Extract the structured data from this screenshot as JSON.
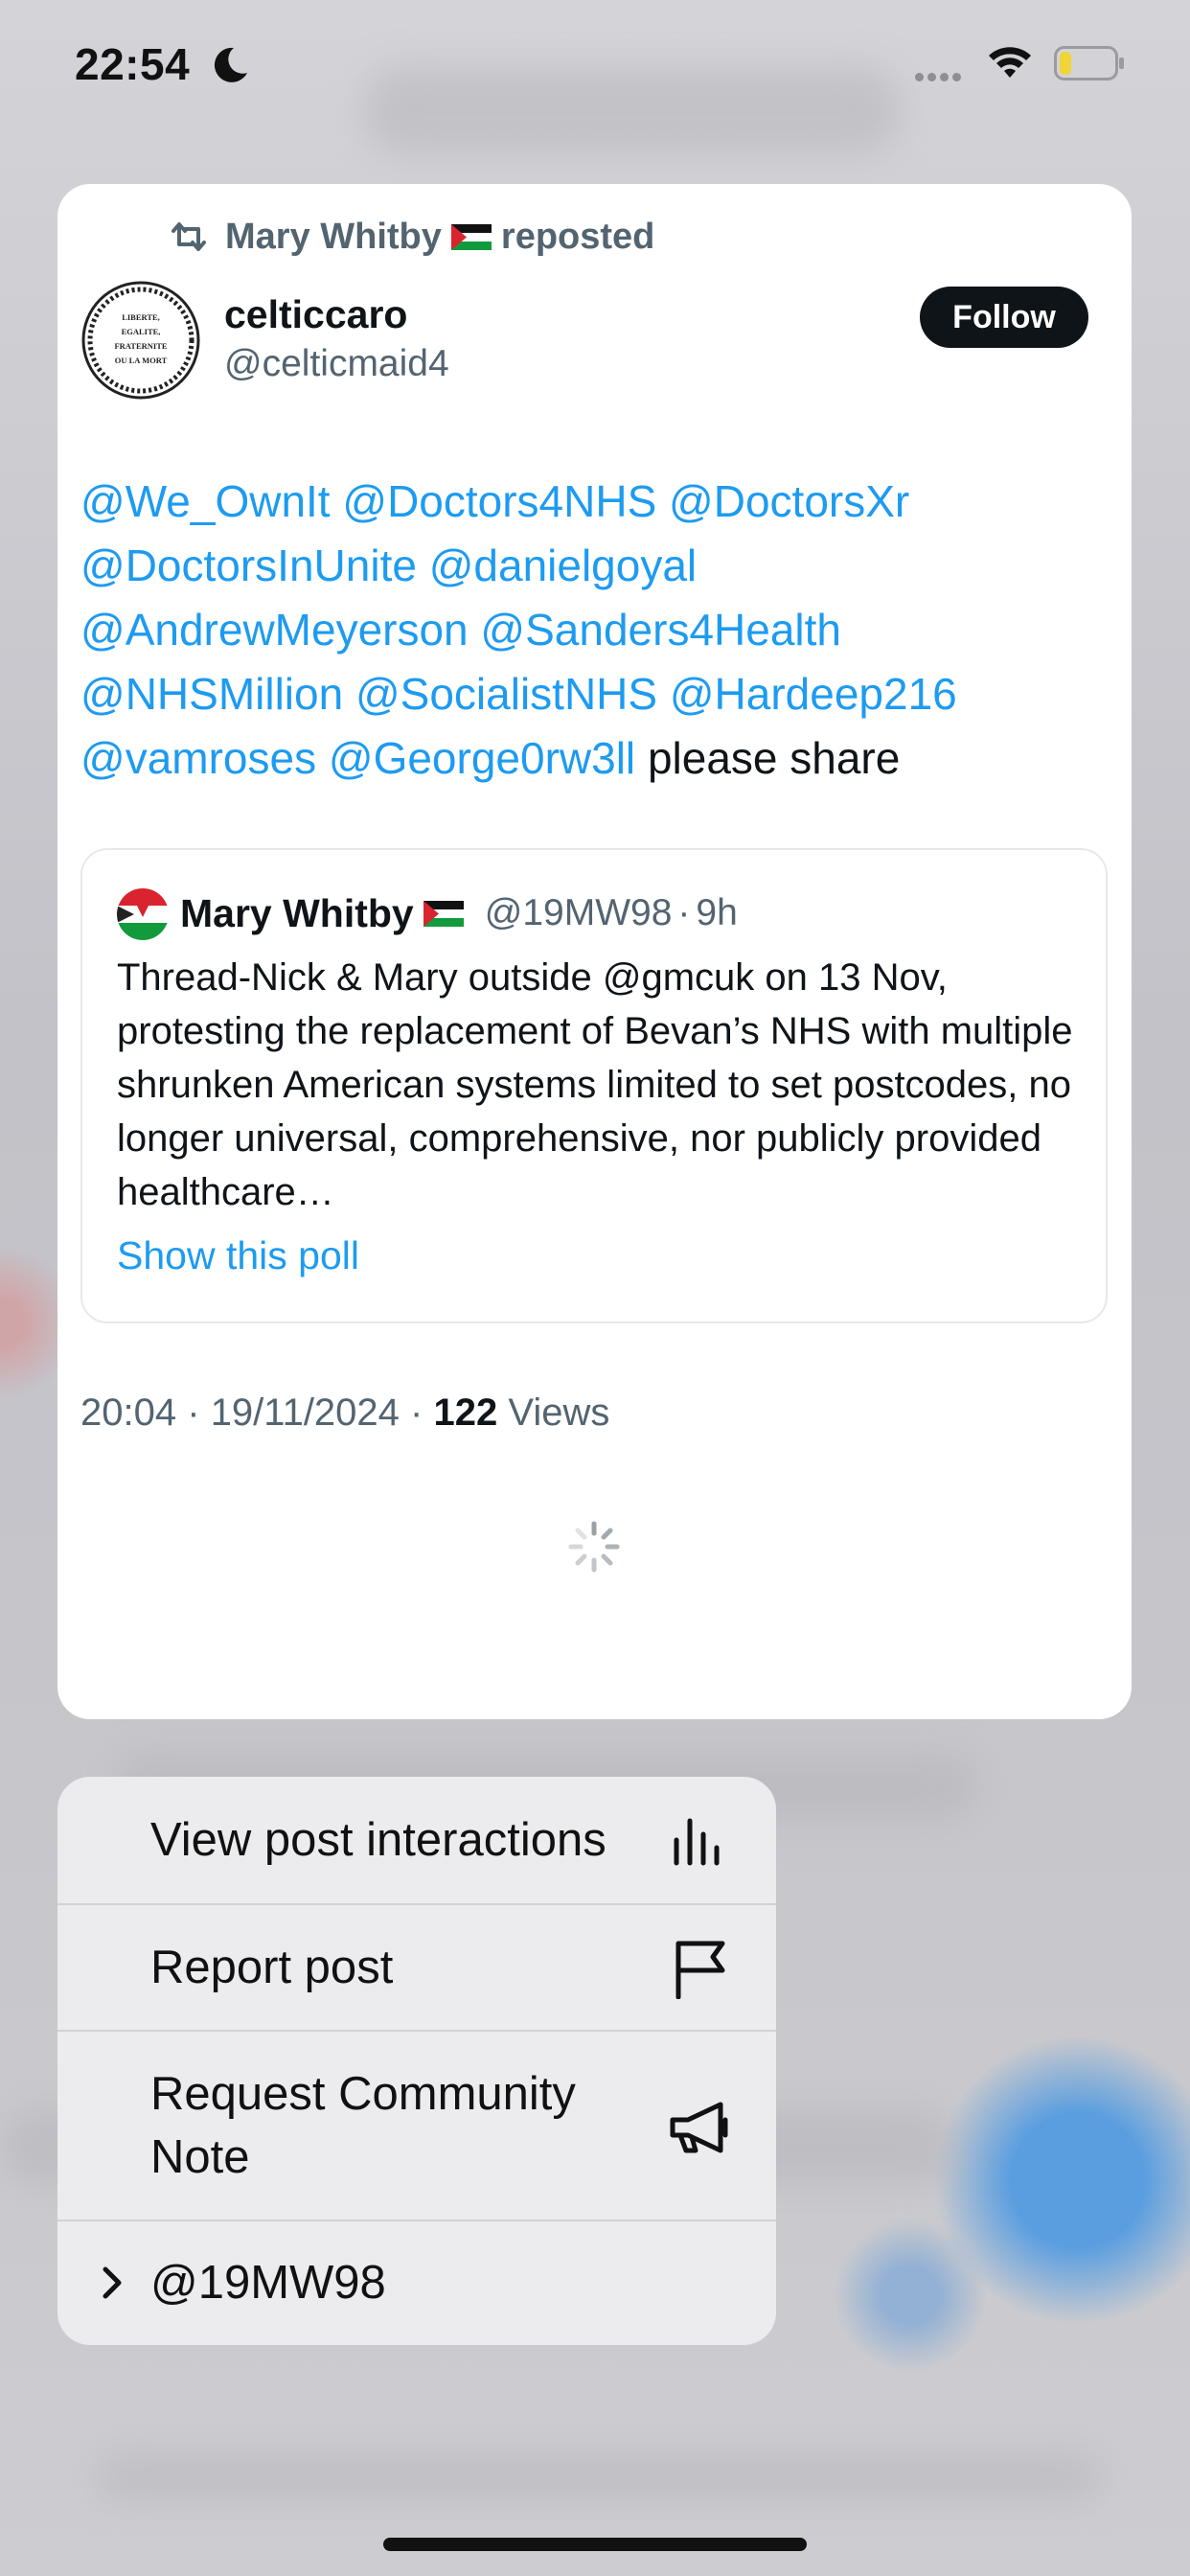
{
  "status_bar": {
    "time": "22:54",
    "icons": [
      "moon-icon",
      "signal-dots-icon",
      "wifi-icon",
      "battery-icon"
    ]
  },
  "post": {
    "repost_by": "Mary Whitby",
    "repost_suffix": "reposted",
    "display_name": "celticcaro",
    "handle": "@celticmaid4",
    "follow_label": "Follow",
    "avatar_text": [
      "LIBERTE,",
      "EGALITE,",
      "FRATERNITE",
      "OU LA MORT"
    ],
    "mentions": [
      "@We_OwnIt",
      "@Doctors4NHS",
      "@DoctorsXr",
      "@DoctorsInUnite",
      "@danielgoyal",
      "@AndrewMeyerson",
      "@Sanders4Health",
      "@NHSMillion",
      "@SocialistNHS",
      "@Hardeep216",
      "@vamroses",
      "@George0rw3ll"
    ],
    "text_tail": "please share",
    "quote": {
      "name": "Mary Whitby",
      "handle": "@19MW98",
      "separator": "·",
      "age": "9h",
      "body": "Thread-Nick & Mary outside @gmcuk on 13 Nov, protesting the replacement of Bevan’s NHS with multiple shrunken American systems limited to set postcodes, no longer universal, comprehensive, nor publicly provided healthcare…",
      "poll_link": "Show this poll"
    },
    "meta": {
      "time": "20:04",
      "date": "19/11/2024",
      "separator": "·",
      "views_count": "122",
      "views_label": "Views"
    }
  },
  "menu": {
    "items": [
      {
        "label": "View post interactions",
        "icon": "bar-chart-icon"
      },
      {
        "label": "Report post",
        "icon": "flag-icon"
      },
      {
        "label": "Request Community Note",
        "icon": "megaphone-icon"
      },
      {
        "label": "@19MW98",
        "icon": "chevron-right-icon"
      }
    ]
  },
  "colors": {
    "accent": "#1d9bf0",
    "text_primary": "#0f1419",
    "text_secondary": "#536471",
    "follow_bg": "#0f1419"
  }
}
